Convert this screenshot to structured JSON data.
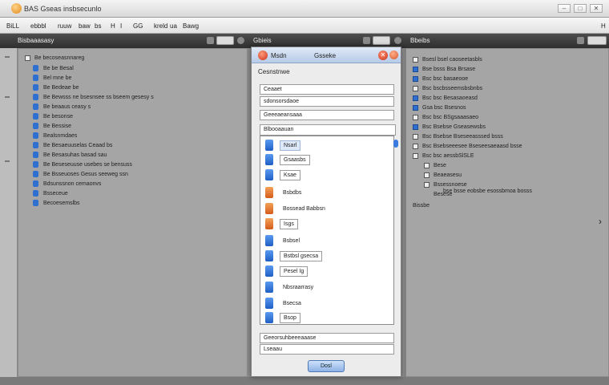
{
  "window": {
    "title": "BAS Gseas insbsecunlo",
    "controls": [
      "–",
      "□",
      "✕"
    ]
  },
  "menu": [
    "BiLL",
    "ebbbl",
    "ruuw",
    "baw",
    "bs",
    "H",
    "I",
    "GG",
    "kreld",
    "ua",
    "Bawg",
    "H"
  ],
  "panel_header": {
    "left": "Bisbaaasasy",
    "center": "Gbieis",
    "right": "Bbeibs"
  },
  "left_tree": [
    "Be becoseasnnareg",
    "Be be Besal",
    "Bel mne be",
    "Be Bedeae be",
    "Be Bewsss ne bsesnsee ss bseem gesesy s",
    "Be beaaus ceasy s",
    "Be besonse",
    "Be Bessise",
    "Bealsnmdaes",
    "Be Besaeuuselas Ceaad bs",
    "Be Besasuhas basad sau",
    "Be Beseseuuse usebes se bensuss",
    "Be Bsseuoses Gesus seeweg ssn",
    "Bdsunssnon cemaonvs",
    "Bsseceue",
    "Becoesemslbs"
  ],
  "dialog": {
    "title_left": "Msdn",
    "title_right": "Gsseke",
    "header": "Cesnstnwe",
    "field1": "Ceaaet",
    "field2": "sdonsorsdaoe",
    "field3": "Geeeaeansaaa",
    "list_title": "Blbooaauan",
    "items": [
      {
        "label": "Nsarl",
        "icon": "blue-doc-icon",
        "style": "selected"
      },
      {
        "label": "Gsaasbs",
        "icon": "blue-doc-icon",
        "style": "boxed"
      },
      {
        "label": "Ksae",
        "icon": "blue-doc-icon",
        "style": "boxed"
      },
      {
        "label": "Bsbdbs",
        "icon": "orange-doc-icon",
        "style": "plain"
      },
      {
        "label": "Bossead Babbsn",
        "icon": "orange-doc-icon",
        "style": "plain"
      },
      {
        "label": "Isgs",
        "icon": "orange-doc-icon",
        "style": "boxed"
      },
      {
        "label": "Bsbsel",
        "icon": "blue-doc-icon",
        "style": "plain"
      },
      {
        "label": "Bstbsl gsecsa",
        "icon": "blue-doc-icon",
        "style": "boxed"
      },
      {
        "label": "Pesel Ig",
        "icon": "blue-doc-icon",
        "style": "boxed"
      },
      {
        "label": "Nbsraarrasy",
        "icon": "blue-doc-icon",
        "style": "plain"
      },
      {
        "label": "Bsecsa",
        "icon": "blue-doc-icon",
        "style": "plain"
      },
      {
        "label": "Bsop",
        "icon": "blue-doc-icon",
        "style": "boxed"
      }
    ],
    "footer1": "Geeorsuhbeeeaaase",
    "footer2": "Lseaau",
    "ok_label": "Dosl"
  },
  "right_list": {
    "rows": [
      {
        "label": "Bsesl bsel caoseetasbls",
        "check": "none"
      },
      {
        "label": "Bse bsss Bsa Brsase",
        "check": "blue"
      },
      {
        "label": "Bsc bsc basaeooe",
        "check": "blue"
      },
      {
        "label": "Bsc bscbsseemsbsbnbs",
        "check": "none"
      },
      {
        "label": "Bsc bsc Besasaoeasd",
        "check": "blue"
      },
      {
        "label": "Gsa bsc Bsesnos",
        "check": "blue"
      },
      {
        "label": "Bsc bsc BSgsaaasaeo",
        "check": "none"
      },
      {
        "label": "Bsc Bsebse Gseasewsbs",
        "check": "blue"
      },
      {
        "label": "Bsc Bsebse Bseseeasssed bsss",
        "check": "none"
      },
      {
        "label": "Bsc Bsebseeesee Bseseesaeaasd bsse",
        "check": "none"
      },
      {
        "label": "Bsc bsc aessbSlSLE",
        "check": "none"
      }
    ],
    "sub_rows": [
      "Bese",
      "Beaeasesu",
      "Bssessnoese",
      "Besese"
    ],
    "last_row": "bse bsse eobsbe esossbmoa bosss",
    "footer": "Bissbe"
  }
}
